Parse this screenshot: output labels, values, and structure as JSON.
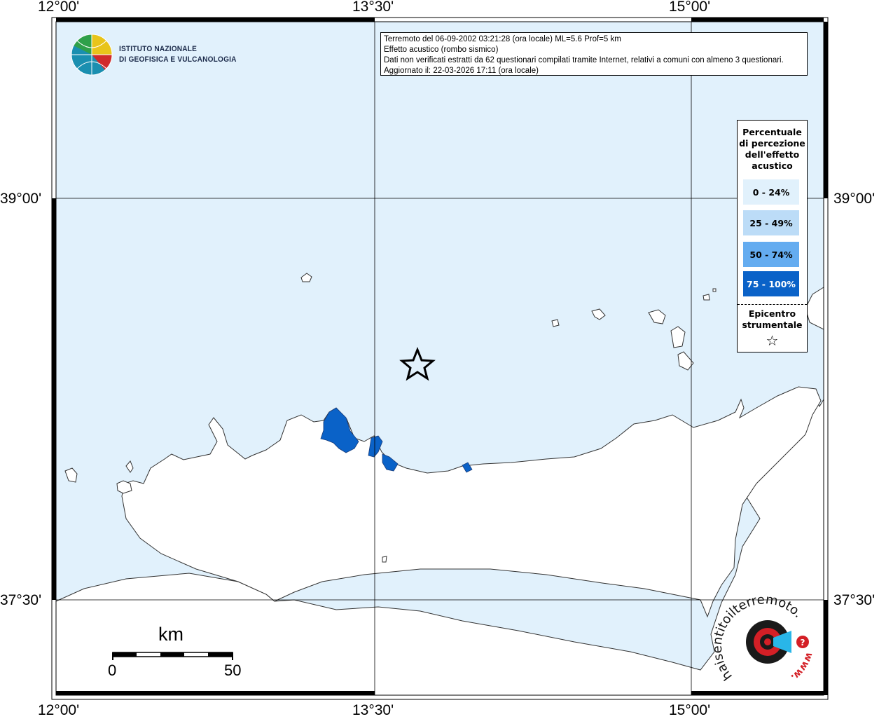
{
  "map": {
    "longitude_ticks": [
      "12°00'",
      "13°30'",
      "15°00'"
    ],
    "latitude_ticks": [
      "39°00'",
      "37°30'"
    ]
  },
  "logo": {
    "line1": "ISTITUTO NAZIONALE",
    "line2": "DI GEOFISICA E VULCANOLOGIA"
  },
  "info": {
    "line1": "Terremoto del 06-09-2002 03:21:28 (ora locale) ML=5.6 Prof=5 km",
    "line2": "Effetto acustico (rombo sismico)",
    "line3": "Dati non verificati estratti da 62 questionari compilati tramite Internet, relativi a comuni con almeno 3 questionari.",
    "line4": "Aggiornato il: 22-03-2026 17:11 (ora locale)"
  },
  "legend": {
    "title_lines": [
      "Percentuale",
      "di percezione",
      "dell'effetto",
      "acustico"
    ],
    "classes": [
      {
        "label": "0 - 24%",
        "color": "#e1f1fc",
        "text_color": "#000000"
      },
      {
        "label": "25 - 49%",
        "color": "#bcdcf7",
        "text_color": "#000000"
      },
      {
        "label": "50 - 74%",
        "color": "#64acf0",
        "text_color": "#000000"
      },
      {
        "label": "75 - 100%",
        "color": "#0a62c8",
        "text_color": "#ffffff"
      }
    ],
    "epicenter_lines": [
      "Epicentro",
      "strumentale"
    ],
    "epicenter_symbol": "☆"
  },
  "scale_bar": {
    "unit": "km",
    "start_label": "0",
    "end_label": "50"
  },
  "hsit_logo": {
    "text": "haisentitoilterremoto.it",
    "prefix": "www."
  },
  "colors": {
    "sea": "#e1f1fc",
    "land": "#ffffff",
    "felt_high": "#0a62c8"
  }
}
